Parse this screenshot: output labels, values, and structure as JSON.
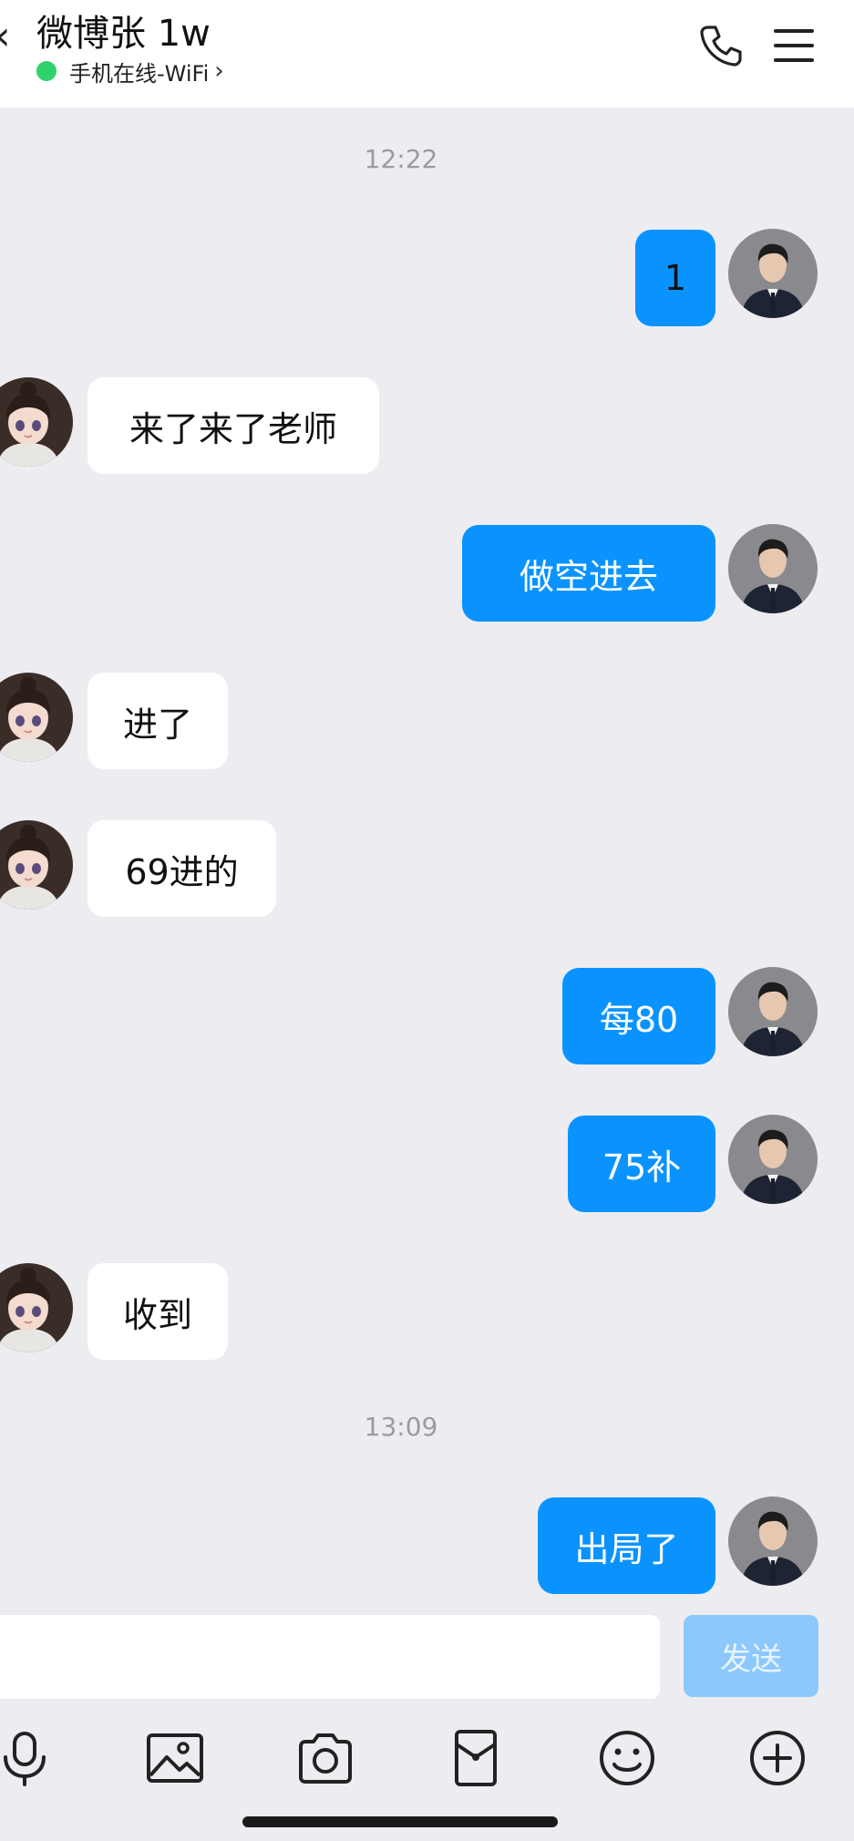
{
  "header": {
    "back_icon": "chevron-left-icon",
    "contact_name": "微博张 1w",
    "status": "手机在线-WiFi",
    "status_chevron": "›",
    "status_color": "#2ed36b",
    "call_icon": "phone-icon",
    "menu_icon": "menu-icon"
  },
  "chat": {
    "timestamp_1": "12:22",
    "timestamp_2": "13:09",
    "messages": [
      {
        "sender": "self",
        "text": "1"
      },
      {
        "sender": "other",
        "text": "来了来了老师"
      },
      {
        "sender": "self",
        "text": "做空进去"
      },
      {
        "sender": "other",
        "text": "进了"
      },
      {
        "sender": "other",
        "text": "69进的"
      },
      {
        "sender": "self",
        "text": "每80"
      },
      {
        "sender": "self",
        "text": "75补"
      },
      {
        "sender": "other",
        "text": "收到"
      },
      {
        "sender": "self",
        "text": "出局了"
      }
    ],
    "outgoing_color": "#0a93ff",
    "incoming_color": "#ffffff"
  },
  "input": {
    "placeholder": "",
    "send_label": "发送"
  },
  "toolbar": {
    "icons": [
      "microphone-icon",
      "image-icon",
      "camera-icon",
      "red-packet-icon",
      "emoji-icon",
      "plus-icon"
    ]
  }
}
